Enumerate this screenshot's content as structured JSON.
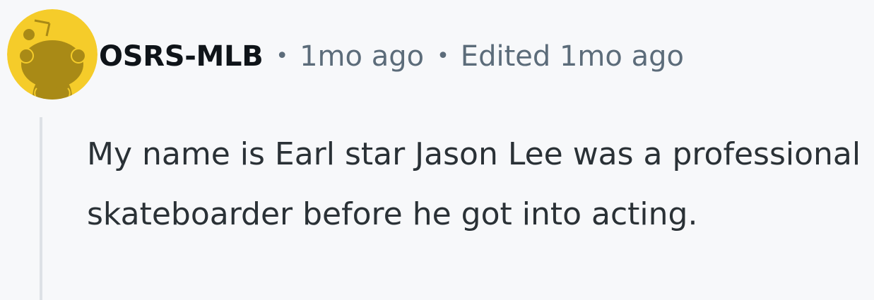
{
  "comment": {
    "username": "OSRS-MLB",
    "separator": "•",
    "timestamp": "1mo ago",
    "edited_label": "Edited 1mo ago",
    "body": "My name is Earl star Jason Lee was a professional skateboarder before he got into acting."
  },
  "avatar": {
    "icon": "snoo-avatar-icon",
    "background_color": "#f5cc2a",
    "figure_color": "#a98a16"
  }
}
